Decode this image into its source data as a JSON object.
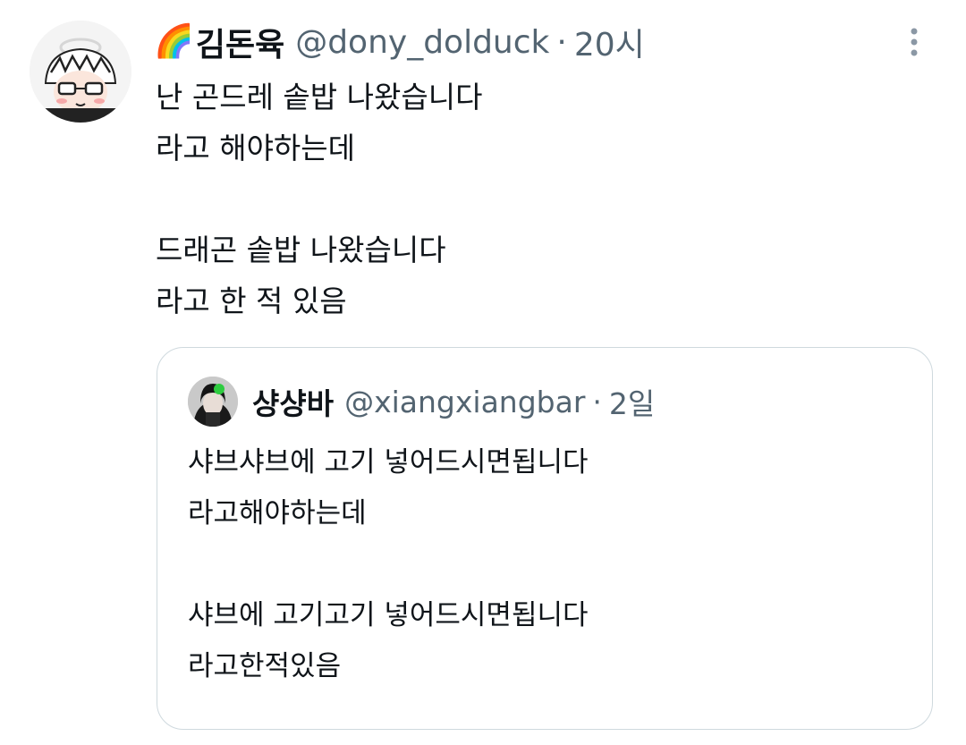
{
  "tweet": {
    "author_emoji": "🌈",
    "author_name": "김돈육",
    "author_handle": "@dony_dolduck",
    "separator": "·",
    "time": "20시",
    "lines": [
      "난 곤드레 솥밥 나왔습니다",
      "라고 해야하는데",
      "",
      "드래곤 솥밥 나왔습니다",
      "라고 한 적 있음"
    ]
  },
  "quote": {
    "author_name": "샹샹바",
    "author_handle": "@xiangxiangbar",
    "separator": "·",
    "time": "2일",
    "lines": [
      "샤브샤브에 고기 넣어드시면됩니다",
      "라고해야하는데",
      "",
      "샤브에 고기고기 넣어드시면됩니다",
      "라고한적있음"
    ]
  },
  "icons": {
    "more": "more-vertical-icon",
    "author_avatar": "cartoon-avatar",
    "quote_avatar": "photo-avatar"
  },
  "colors": {
    "text": "#0f1419",
    "secondary": "#536471",
    "border": "#cfd9de",
    "quote_avatar_accent": "#2ecc40"
  }
}
